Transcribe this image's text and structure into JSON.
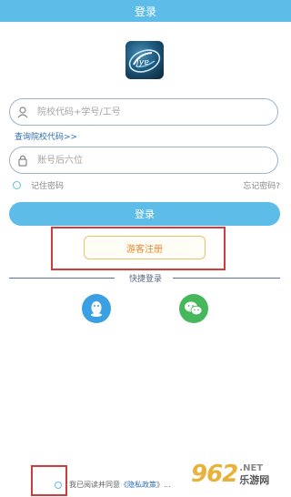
{
  "header": {
    "title": "登录"
  },
  "form": {
    "account_placeholder": "院校代码+学号/工号",
    "lookup_link": "查询院校代码>>",
    "password_placeholder": "账号后六位",
    "remember_label": "记住密码",
    "forgot_label": "忘记密码?",
    "login_label": "登录"
  },
  "guest": {
    "register_label": "游客注册"
  },
  "quick_login": {
    "label": "快捷登录"
  },
  "footer": {
    "agree_prefix": "我已阅读并同意",
    "policy_text": "《隐私政策",
    "agree_rest": "》..."
  },
  "watermark": {
    "number": "962",
    "net": ".NET",
    "site": "乐游网"
  },
  "colors": {
    "accent": "#5ebde8",
    "highlight_box": "#d33a3a",
    "qq": "#3aa0e3",
    "wechat": "#45b85b"
  },
  "icons": [
    "user-icon",
    "lock-icon",
    "qq-icon",
    "wechat-icon",
    "app-logo"
  ]
}
